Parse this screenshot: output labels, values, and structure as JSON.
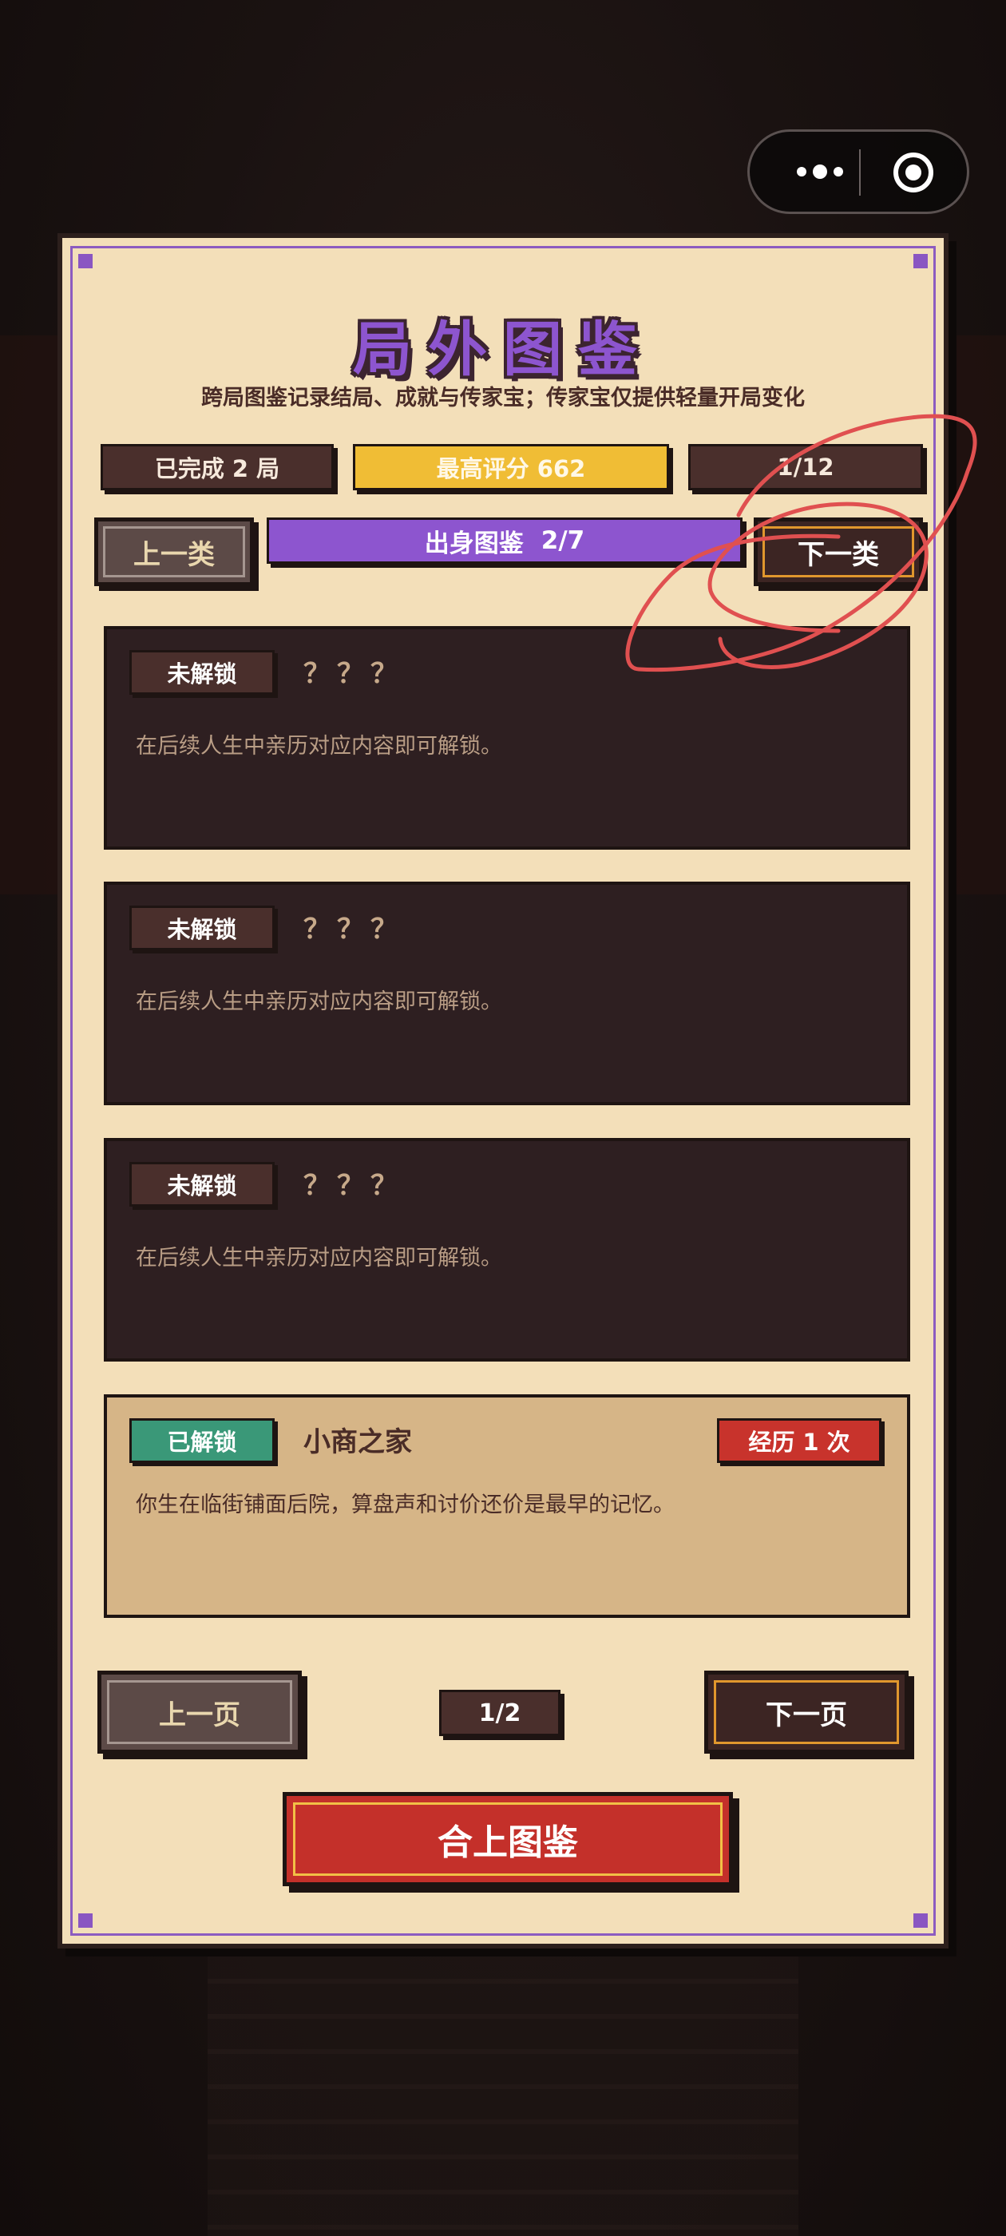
{
  "panel": {
    "title": "局外图鉴",
    "subtitle": "跨局图鉴记录结局、成就与传家宝；传家宝仅提供轻量开局变化"
  },
  "stats": {
    "completed": "已完成 2 局",
    "best_score": "最高评分 662",
    "progress": "1/12"
  },
  "category_nav": {
    "prev_label": "上一类",
    "next_label": "下一类",
    "category_name": "出身图鉴",
    "category_index": "2/7"
  },
  "entries": [
    {
      "status": "未解锁",
      "name": "？？？",
      "description": "在后续人生中亲历对应内容即可解锁。"
    },
    {
      "status": "未解锁",
      "name": "？？？",
      "description": "在后续人生中亲历对应内容即可解锁。"
    },
    {
      "status": "未解锁",
      "name": "？？？",
      "description": "在后续人生中亲历对应内容即可解锁。"
    },
    {
      "status": "已解锁",
      "name": "小商之家",
      "description": "你生在临街铺面后院，算盘声和讨价还价是最早的记忆。",
      "badge": "经历 1 次"
    }
  ],
  "pagination": {
    "prev_label": "上一页",
    "next_label": "下一页",
    "indicator": "1/2"
  },
  "close_label": "合上图鉴",
  "colors": {
    "panel_bg": "#f3dfb9",
    "accent_purple": "#8d55cf",
    "gold": "#f0bd35",
    "locked_card": "#2e1f21",
    "unlocked_card": "#d6b587",
    "unlocked_tag": "#3a9878",
    "red": "#c4302a",
    "annotation_stroke": "#e05050"
  },
  "icons": {
    "capsule_menu": "more-dots-icon",
    "capsule_close": "target-circle-icon"
  }
}
